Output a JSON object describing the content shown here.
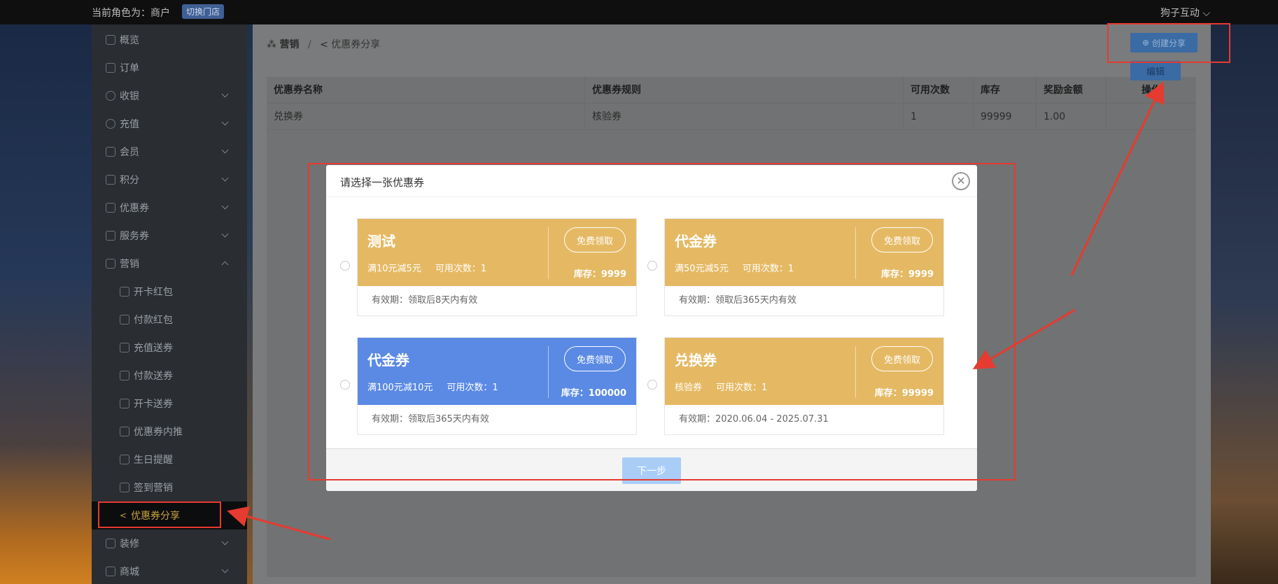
{
  "topbar": {
    "role_label": "当前角色为：商户",
    "switch_label": "切换门店",
    "user_label": "狗子互动"
  },
  "sidebar": {
    "items": [
      {
        "label": "概览"
      },
      {
        "label": "订单"
      },
      {
        "label": "收银"
      },
      {
        "label": "充值"
      },
      {
        "label": "会员"
      },
      {
        "label": "积分"
      },
      {
        "label": "优惠券"
      },
      {
        "label": "服务券"
      },
      {
        "label": "营销"
      }
    ],
    "sub_items": [
      {
        "label": "开卡红包"
      },
      {
        "label": "付款红包"
      },
      {
        "label": "充值送券"
      },
      {
        "label": "付款送券"
      },
      {
        "label": "开卡送券"
      },
      {
        "label": "优惠券内推"
      },
      {
        "label": "生日提醒"
      },
      {
        "label": "签到营销"
      }
    ],
    "active_label": "优惠券分享",
    "bottom_items": [
      {
        "label": "装修"
      },
      {
        "label": "商城"
      }
    ]
  },
  "breadcrumb": {
    "crumb1": "营销",
    "separator": "/",
    "crumb2": "优惠券分享"
  },
  "toolbar": {
    "create_label": "创建分享"
  },
  "table": {
    "headers": [
      "优惠券名称",
      "优惠券规则",
      "可用次数",
      "库存",
      "奖励金额",
      "操作"
    ],
    "rows": [
      [
        "兑换券",
        "核验券",
        "1",
        "99999",
        "1.00"
      ]
    ],
    "edit_label": "编辑"
  },
  "modal": {
    "title": "请选择一张优惠券",
    "close_symbol": "✕",
    "next_label": "下一步",
    "coupons": [
      {
        "name": "测试",
        "rule": "满10元减5元",
        "uses": "可用次数：1",
        "stock": "库存：9999",
        "validity": "有效期：领取后8天内有效",
        "button": "免费领取",
        "color": "#e5b963"
      },
      {
        "name": "代金券",
        "rule": "满50元减5元",
        "uses": "可用次数：1",
        "stock": "库存：9999",
        "validity": "有效期：领取后365天内有效",
        "button": "免费领取",
        "color": "#e5b963"
      },
      {
        "name": "代金券",
        "rule": "满100元减10元",
        "uses": "可用次数：1",
        "stock": "库存：100000",
        "validity": "有效期：领取后365天内有效",
        "button": "免费领取",
        "color": "#5b8ae5"
      },
      {
        "name": "兑换券",
        "rule": "核验券",
        "uses": "可用次数：1",
        "stock": "库存：99999",
        "validity": "有效期：2020.06.04 - 2025.07.31",
        "button": "免费领取",
        "color": "#e5b963"
      }
    ]
  },
  "colors": {
    "accent_red": "#e53b30",
    "primary_blue": "#3a6ba5",
    "coupon_gold": "#e5b963",
    "coupon_blue": "#5b8ae5"
  }
}
